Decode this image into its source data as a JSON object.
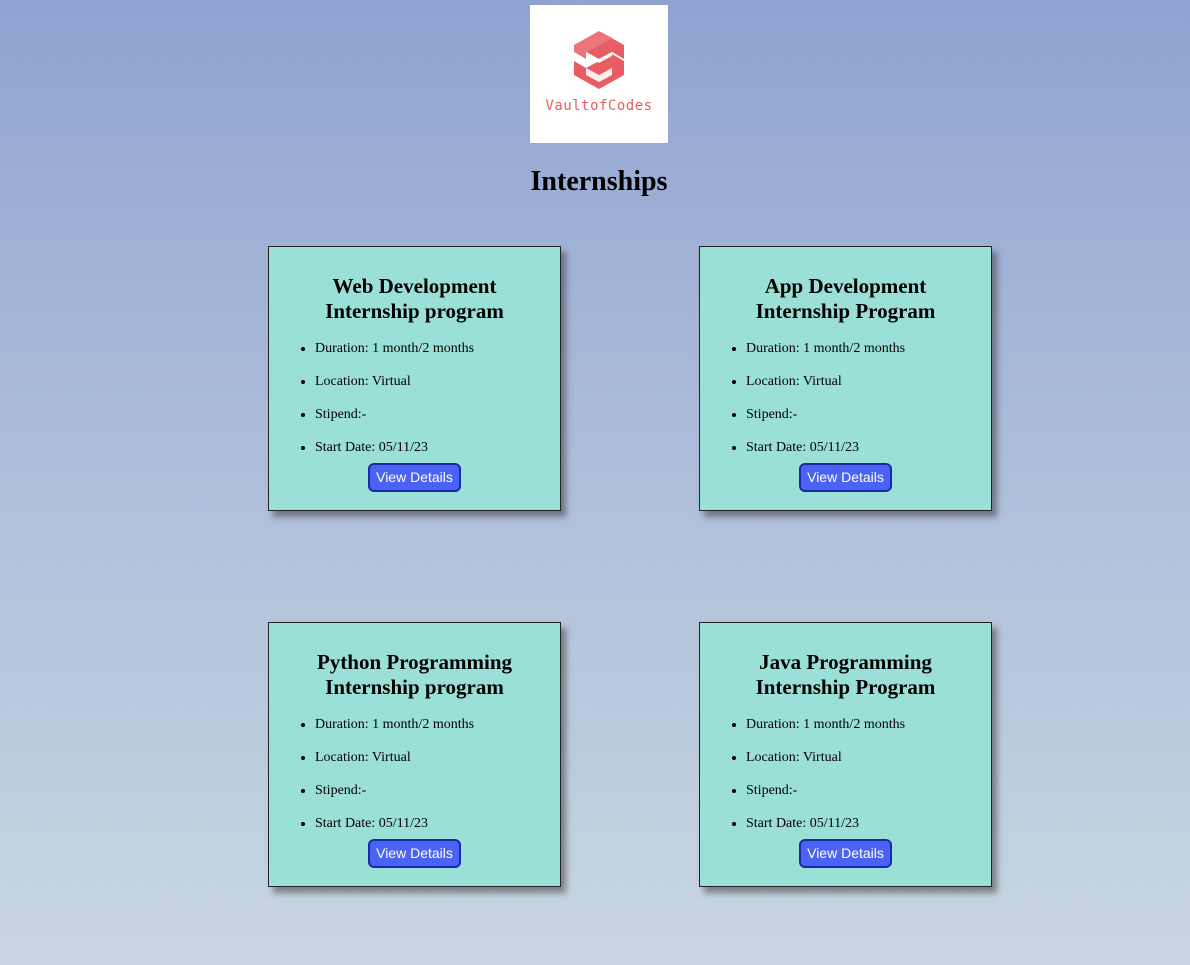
{
  "logo": {
    "text": "VaultofCodes",
    "color": "#e85d63"
  },
  "page_title": "Internships",
  "cards": [
    {
      "title": "Web Development Internship program",
      "details": [
        "Duration: 1 month/2 months",
        "Location: Virtual",
        "Stipend:-",
        "Start Date: 05/11/23"
      ],
      "button": "View Details"
    },
    {
      "title": "App Development Internship Program",
      "details": [
        "Duration: 1 month/2 months",
        "Location: Virtual",
        "Stipend:-",
        "Start Date: 05/11/23"
      ],
      "button": "View Details"
    },
    {
      "title": "Python Programming Internship program",
      "details": [
        "Duration: 1 month/2 months",
        "Location: Virtual",
        "Stipend:-",
        "Start Date: 05/11/23"
      ],
      "button": "View Details"
    },
    {
      "title": "Java Programming Internship Program",
      "details": [
        "Duration: 1 month/2 months",
        "Location: Virtual",
        "Stipend:-",
        "Start Date: 05/11/23"
      ],
      "button": "View Details"
    }
  ],
  "colors": {
    "card_background": "#9be0d6",
    "button_background": "#4a63f5",
    "button_border": "#1a2aa8"
  }
}
